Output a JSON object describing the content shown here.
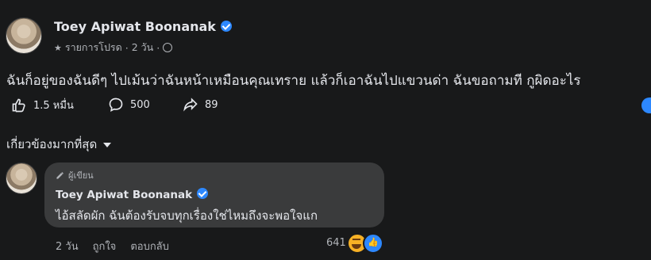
{
  "post": {
    "author": "Toey Apiwat Boonanak",
    "meta_role": "รายการโปรด",
    "meta_time": "2 วัน",
    "meta_privacy_icon": "globe-icon",
    "text": "ฉันก็อยู่ของฉันดีๆ ไปเม้นว่าฉันหน้าเหมือนคุณเทราย แล้วก็เอาฉันไปแขวนด่า ฉันขอถามที กูผิดอะไร",
    "stats": {
      "likes": "1.5 หมื่น",
      "comments": "500",
      "shares": "89"
    }
  },
  "sort": {
    "label": "เกี่ยวข้องมากที่สุด"
  },
  "comment": {
    "badge": "ผู้เขียน",
    "author": "Toey Apiwat Boonanak",
    "text": "ไอ้สลัดผัก ฉันต้องรับจบทุกเรื่องใช่ไหมถึงจะพอใจแก",
    "time": "2 วัน",
    "like_label": "ถูกใจ",
    "reply_label": "ตอบกลับ",
    "reaction_count": "641"
  },
  "colors": {
    "background": "#18191a",
    "bubble": "#3a3b3c",
    "accent": "#2d88ff"
  }
}
